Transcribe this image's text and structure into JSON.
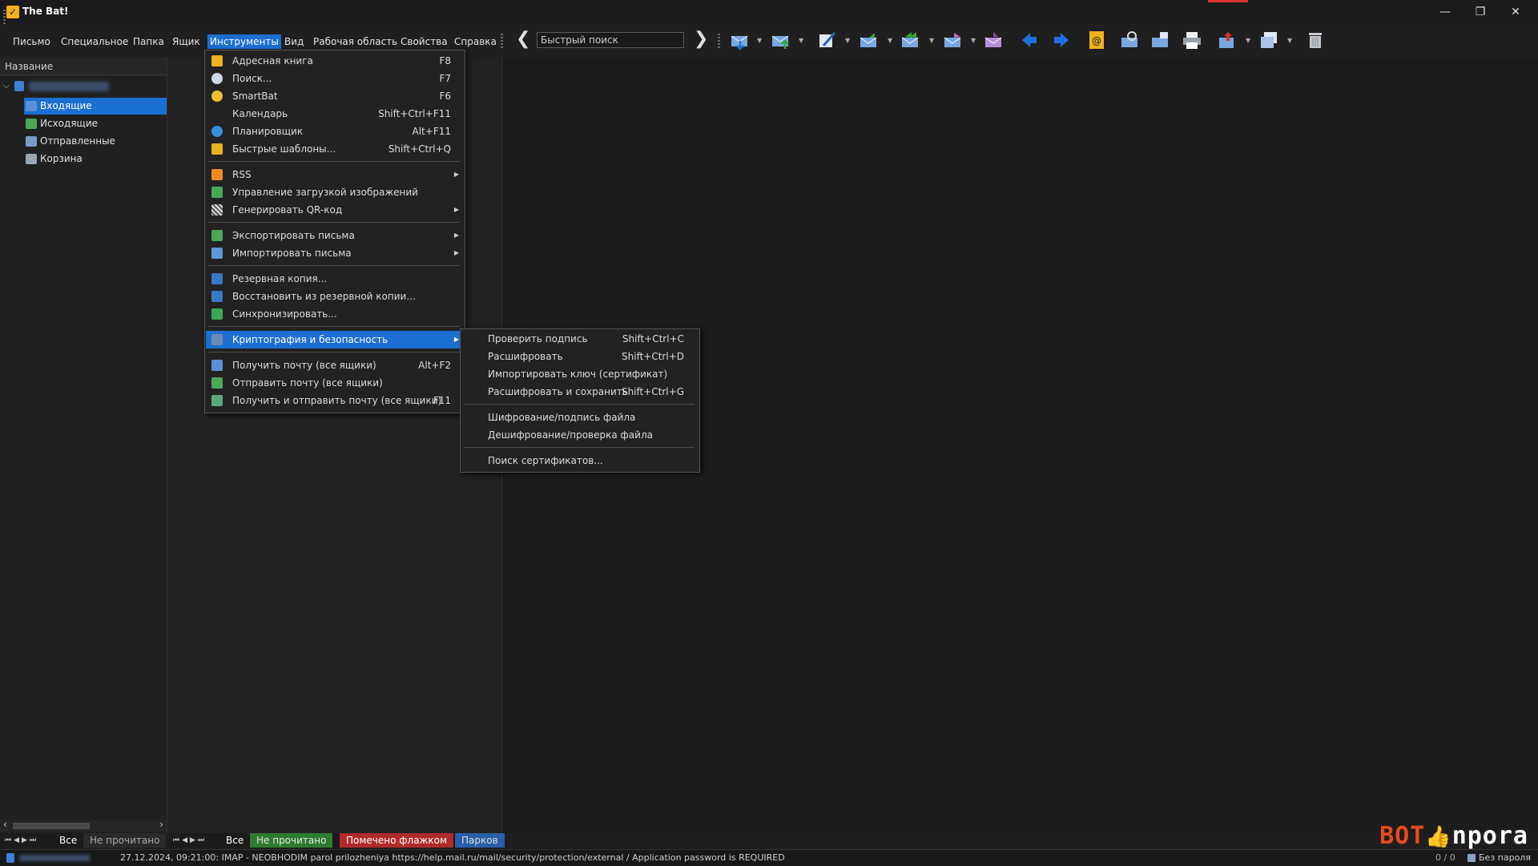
{
  "window": {
    "title": "The Bat!",
    "app_icon": "bat-logo-icon",
    "controls": [
      "—",
      "❐",
      "✕"
    ]
  },
  "menubar": {
    "items": [
      "Письмо",
      "Специальное",
      "Папка",
      "Ящик",
      "Инструменты",
      "Вид",
      "Рабочая область",
      "Свойства",
      "Справка"
    ],
    "active_index": 4
  },
  "search": {
    "placeholder": "Быстрый поиск",
    "prev_arrow": "❮",
    "next_arrow": "❯"
  },
  "toolbar": {
    "icons": [
      "get-mail-icon",
      "send-mail-icon",
      "new-message-icon",
      "reply-icon",
      "reply-all-icon",
      "forward-icon",
      "redirect-icon",
      "back-icon",
      "forward-arrow-icon",
      "address-book-icon",
      "check-mail-icon",
      "outbox-icon",
      "print-icon",
      "move-icon",
      "copy-icon",
      "delete-icon"
    ],
    "accent": "#1b6fd2"
  },
  "folder_panel": {
    "header": "Название",
    "folders": [
      {
        "label": "Входящие",
        "selected": true,
        "icon": "inbox-icon"
      },
      {
        "label": "Исходящие",
        "selected": false,
        "icon": "outbox-icon"
      },
      {
        "label": "Отправленные",
        "selected": false,
        "icon": "sent-icon"
      },
      {
        "label": "Корзина",
        "selected": false,
        "icon": "trash-icon"
      }
    ]
  },
  "tools_menu": {
    "items": [
      {
        "label": "Адресная книга",
        "shortcut": "F8",
        "icon": "address-book-icon"
      },
      {
        "label": "Поиск...",
        "shortcut": "F7",
        "icon": "search-icon"
      },
      {
        "label": "SmartBat",
        "shortcut": "F6",
        "icon": "smartbat-icon"
      },
      {
        "label": "Календарь",
        "shortcut": "Shift+Ctrl+F11",
        "icon": "calendar-icon"
      },
      {
        "label": "Планировщик",
        "shortcut": "Alt+F11",
        "icon": "scheduler-icon"
      },
      {
        "label": "Быстрые шаблоны...",
        "shortcut": "Shift+Ctrl+Q",
        "icon": "templates-icon"
      },
      {
        "label": "RSS",
        "shortcut": "",
        "icon": "rss-icon",
        "submenu": true
      },
      {
        "label": "Управление загрузкой изображений",
        "shortcut": "",
        "icon": "image-download-icon"
      },
      {
        "label": "Генерировать QR-код",
        "shortcut": "",
        "icon": "qr-code-icon",
        "submenu": true
      },
      {
        "label": "Экспортировать письма",
        "shortcut": "",
        "icon": "export-icon",
        "submenu": true
      },
      {
        "label": "Импортировать письма",
        "shortcut": "",
        "icon": "import-icon",
        "submenu": true
      },
      {
        "label": "Резервная копия...",
        "shortcut": "",
        "icon": "backup-icon"
      },
      {
        "label": "Восстановить из резервной копии...",
        "shortcut": "",
        "icon": "restore-icon"
      },
      {
        "label": "Синхронизировать...",
        "shortcut": "",
        "icon": "sync-icon"
      },
      {
        "label": "Криптография и безопасность",
        "shortcut": "",
        "icon": "crypto-icon",
        "submenu": true,
        "highlighted": true
      },
      {
        "label": "Получить почту (все ящики)",
        "shortcut": "Alt+F2",
        "icon": "get-all-icon"
      },
      {
        "label": "Отправить почту (все ящики)",
        "shortcut": "",
        "icon": "send-all-icon"
      },
      {
        "label": "Получить и отправить почту (все ящики)",
        "shortcut": "F11",
        "icon": "get-send-all-icon"
      }
    ]
  },
  "crypto_submenu": {
    "items": [
      {
        "label": "Проверить подпись",
        "shortcut": "Shift+Ctrl+C"
      },
      {
        "label": "Расшифровать",
        "shortcut": "Shift+Ctrl+D"
      },
      {
        "label": "Импортировать ключ (сертификат)",
        "shortcut": ""
      },
      {
        "label": "Расшифровать и сохранить",
        "shortcut": "Shift+Ctrl+G"
      },
      {
        "label": "Шифрование/подпись файла",
        "shortcut": ""
      },
      {
        "label": "Дешифрование/проверка файла",
        "shortcut": ""
      },
      {
        "label": "Поиск сертификатов...",
        "shortcut": ""
      }
    ]
  },
  "bottom_tabs_left": {
    "tabs": [
      "Все",
      "Не прочитано"
    ]
  },
  "bottom_tabs_mid": {
    "tabs": [
      "Все",
      "Не прочитано",
      "Помечено флажком",
      "Парков"
    ]
  },
  "status": {
    "message": "27.12.2024, 09:21:00: IMAP  - NEOBHODIM parol prilozheniya https://help.mail.ru/mail/security/protection/external / Application password is REQUIRED",
    "counter": "0 / 0",
    "password_state": "Без пароля"
  },
  "watermark": {
    "part1": "BOT",
    "part2": "npora"
  }
}
